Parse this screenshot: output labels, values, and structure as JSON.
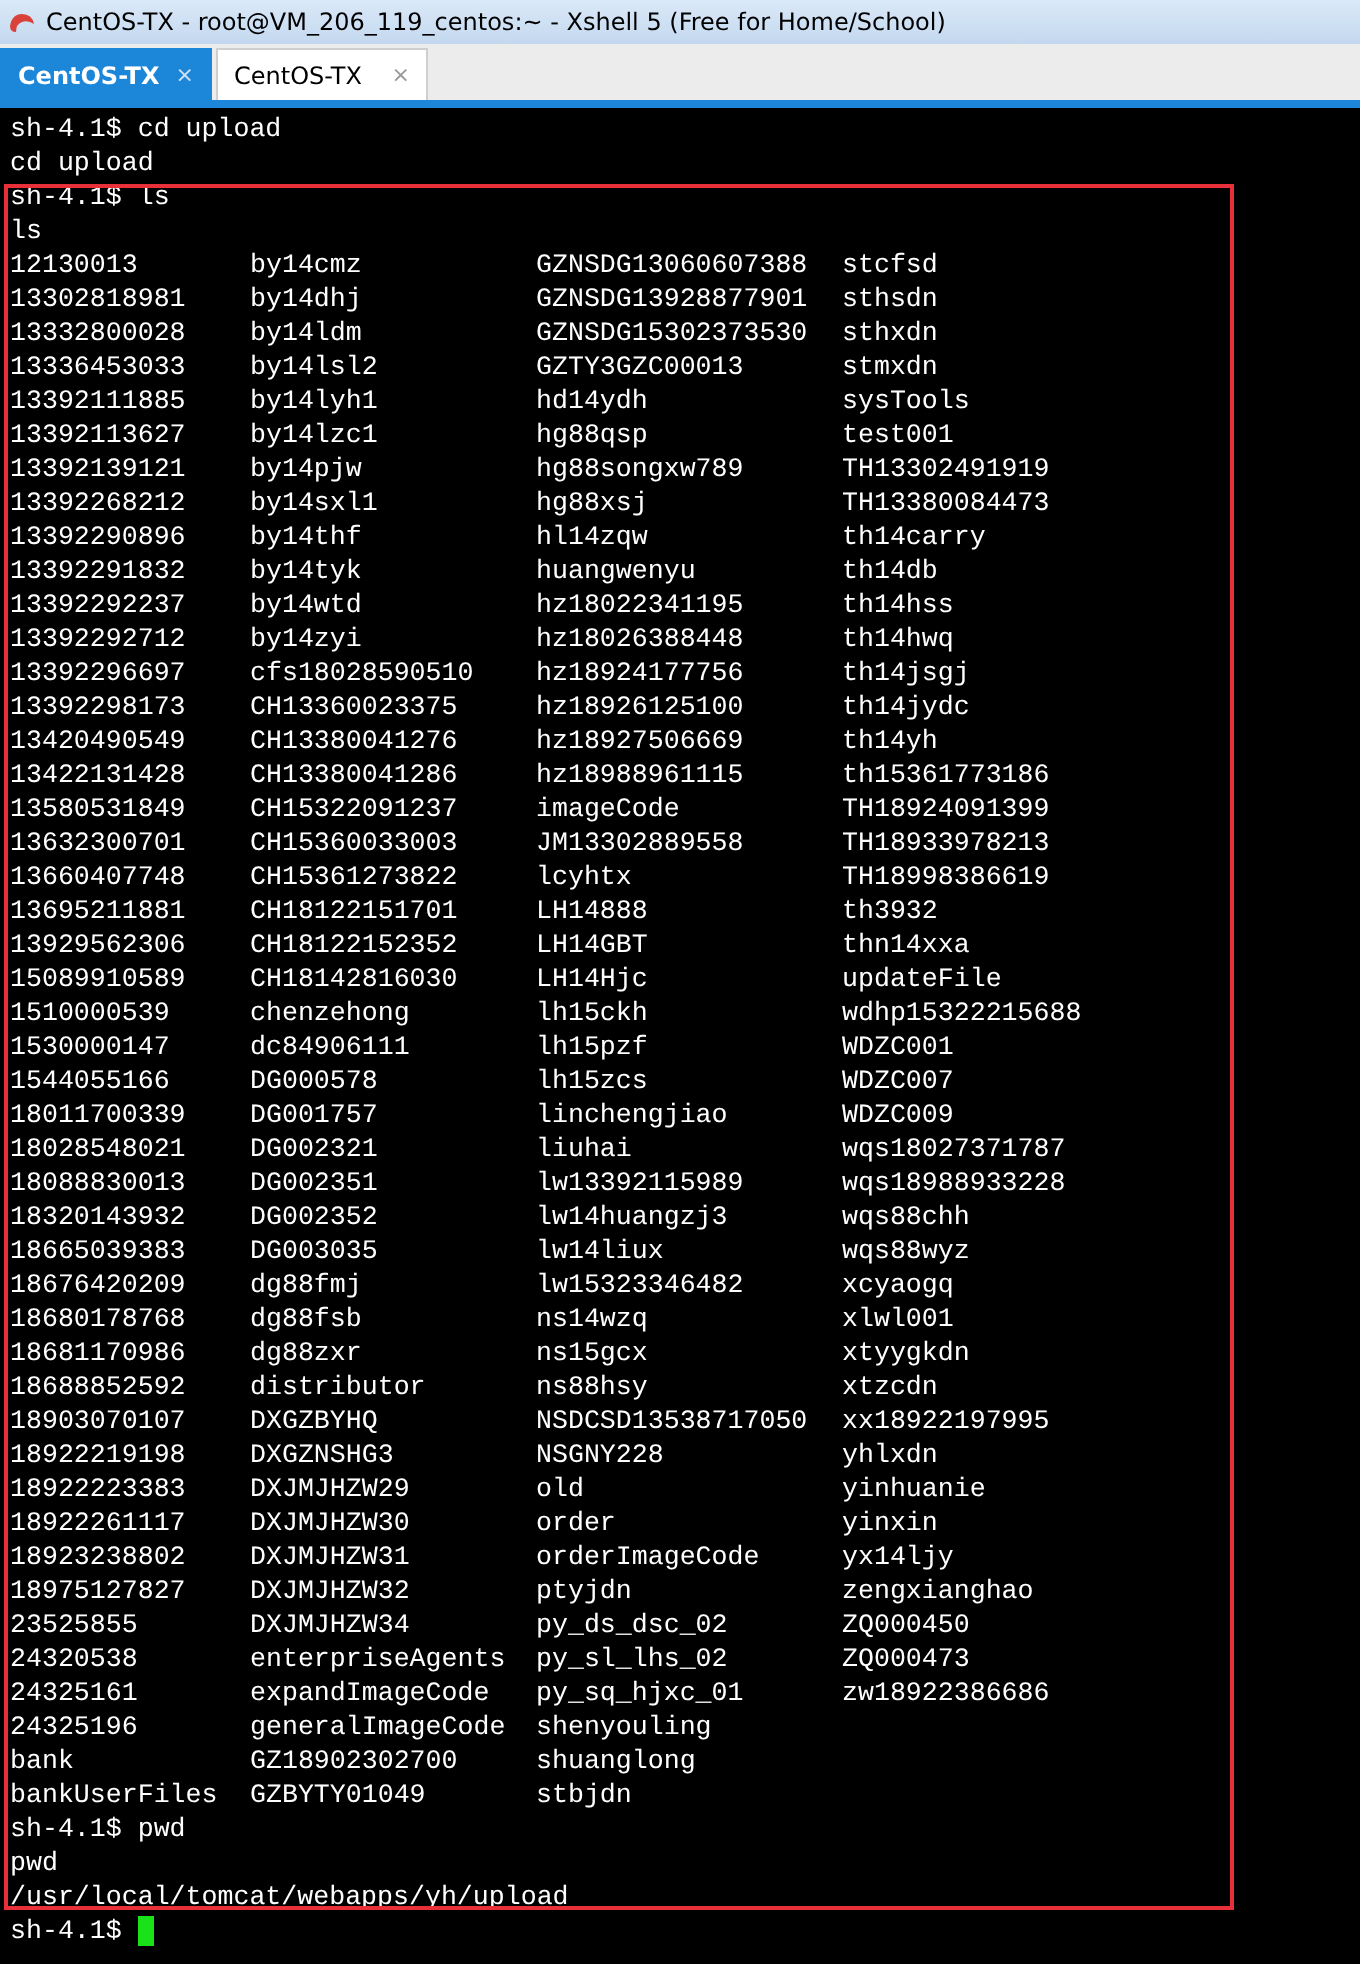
{
  "window": {
    "title": "CentOS-TX - root@VM_206_119_centos:~ - Xshell 5 (Free for Home/School)"
  },
  "tabs": [
    {
      "label": "CentOS-TX",
      "close": "×",
      "selected": true
    },
    {
      "label": "CentOS-TX",
      "close": "×",
      "selected": false
    }
  ],
  "terminal": {
    "lines": [
      {
        "kind": "text",
        "text": "sh-4.1$ cd upload"
      },
      {
        "kind": "text",
        "text": "cd upload"
      },
      {
        "kind": "text",
        "text": "sh-4.1$ ls"
      },
      {
        "kind": "text",
        "text": "ls"
      },
      {
        "kind": "listing",
        "rows": [
          [
            "12130013",
            "by14cmz",
            "GZNSDG13060607388",
            "stcfsd"
          ],
          [
            "13302818981",
            "by14dhj",
            "GZNSDG13928877901",
            "sthsdn"
          ],
          [
            "13332800028",
            "by14ldm",
            "GZNSDG15302373530",
            "sthxdn"
          ],
          [
            "13336453033",
            "by14lsl2",
            "GZTY3GZC00013",
            "stmxdn"
          ],
          [
            "13392111885",
            "by14lyh1",
            "hd14ydh",
            "sysTools"
          ],
          [
            "13392113627",
            "by14lzc1",
            "hg88qsp",
            "test001"
          ],
          [
            "13392139121",
            "by14pjw",
            "hg88songxw789",
            "TH13302491919"
          ],
          [
            "13392268212",
            "by14sxl1",
            "hg88xsj",
            "TH13380084473"
          ],
          [
            "13392290896",
            "by14thf",
            "hl14zqw",
            "th14carry"
          ],
          [
            "13392291832",
            "by14tyk",
            "huangwenyu",
            "th14db"
          ],
          [
            "13392292237",
            "by14wtd",
            "hz18022341195",
            "th14hss"
          ],
          [
            "13392292712",
            "by14zyi",
            "hz18026388448",
            "th14hwq"
          ],
          [
            "13392296697",
            "cfs18028590510",
            "hz18924177756",
            "th14jsgj"
          ],
          [
            "13392298173",
            "CH13360023375",
            "hz18926125100",
            "th14jydc"
          ],
          [
            "13420490549",
            "CH13380041276",
            "hz18927506669",
            "th14yh"
          ],
          [
            "13422131428",
            "CH13380041286",
            "hz18988961115",
            "th15361773186"
          ],
          [
            "13580531849",
            "CH15322091237",
            "imageCode",
            "TH18924091399"
          ],
          [
            "13632300701",
            "CH15360033003",
            "JM13302889558",
            "TH18933978213"
          ],
          [
            "13660407748",
            "CH15361273822",
            "lcyhtx",
            "TH18998386619"
          ],
          [
            "13695211881",
            "CH18122151701",
            "LH14888",
            "th3932"
          ],
          [
            "13929562306",
            "CH18122152352",
            "LH14GBT",
            "thn14xxa"
          ],
          [
            "15089910589",
            "CH18142816030",
            "LH14Hjc",
            "updateFile"
          ],
          [
            "1510000539",
            "chenzehong",
            "lh15ckh",
            "wdhp15322215688"
          ],
          [
            "1530000147",
            "dc84906111",
            "lh15pzf",
            "WDZC001"
          ],
          [
            "1544055166",
            "DG000578",
            "lh15zcs",
            "WDZC007"
          ],
          [
            "18011700339",
            "DG001757",
            "linchengjiao",
            "WDZC009"
          ],
          [
            "18028548021",
            "DG002321",
            "liuhai",
            "wqs18027371787"
          ],
          [
            "18088830013",
            "DG002351",
            "lw13392115989",
            "wqs18988933228"
          ],
          [
            "18320143932",
            "DG002352",
            "lw14huangzj3",
            "wqs88chh"
          ],
          [
            "18665039383",
            "DG003035",
            "lw14liux",
            "wqs88wyz"
          ],
          [
            "18676420209",
            "dg88fmj",
            "lw15323346482",
            "xcyaogq"
          ],
          [
            "18680178768",
            "dg88fsb",
            "ns14wzq",
            "xlwl001"
          ],
          [
            "18681170986",
            "dg88zxr",
            "ns15gcx",
            "xtyygkdn"
          ],
          [
            "18688852592",
            "distributor",
            "ns88hsy",
            "xtzcdn"
          ],
          [
            "18903070107",
            "DXGZBYHQ",
            "NSDCSD13538717050",
            "xx18922197995"
          ],
          [
            "18922219198",
            "DXGZNSHG3",
            "NSGNY228",
            "yhlxdn"
          ],
          [
            "18922223383",
            "DXJMJHZW29",
            "old",
            "yinhuanie"
          ],
          [
            "18922261117",
            "DXJMJHZW30",
            "order",
            "yinxin"
          ],
          [
            "18923238802",
            "DXJMJHZW31",
            "orderImageCode",
            "yx14ljy"
          ],
          [
            "18975127827",
            "DXJMJHZW32",
            "ptyjdn",
            "zengxianghao"
          ],
          [
            "23525855",
            "DXJMJHZW34",
            "py_ds_dsc_02",
            "ZQ000450"
          ],
          [
            "24320538",
            "enterpriseAgents",
            "py_sl_lhs_02",
            "ZQ000473"
          ],
          [
            "24325161",
            "expandImageCode",
            "py_sq_hjxc_01",
            "zw18922386686"
          ],
          [
            "24325196",
            "generalImageCode",
            "shenyouling"
          ],
          [
            "bank",
            "GZ18902302700",
            "shuanglong"
          ],
          [
            "bankUserFiles",
            "GZBYTY01049",
            "stbjdn"
          ]
        ]
      },
      {
        "kind": "text",
        "text": "sh-4.1$ pwd"
      },
      {
        "kind": "text",
        "text": "pwd"
      },
      {
        "kind": "text",
        "text": "/usr/local/tomcat/webapps/yh/upload"
      },
      {
        "kind": "prompt",
        "text": "sh-4.1$"
      }
    ]
  }
}
